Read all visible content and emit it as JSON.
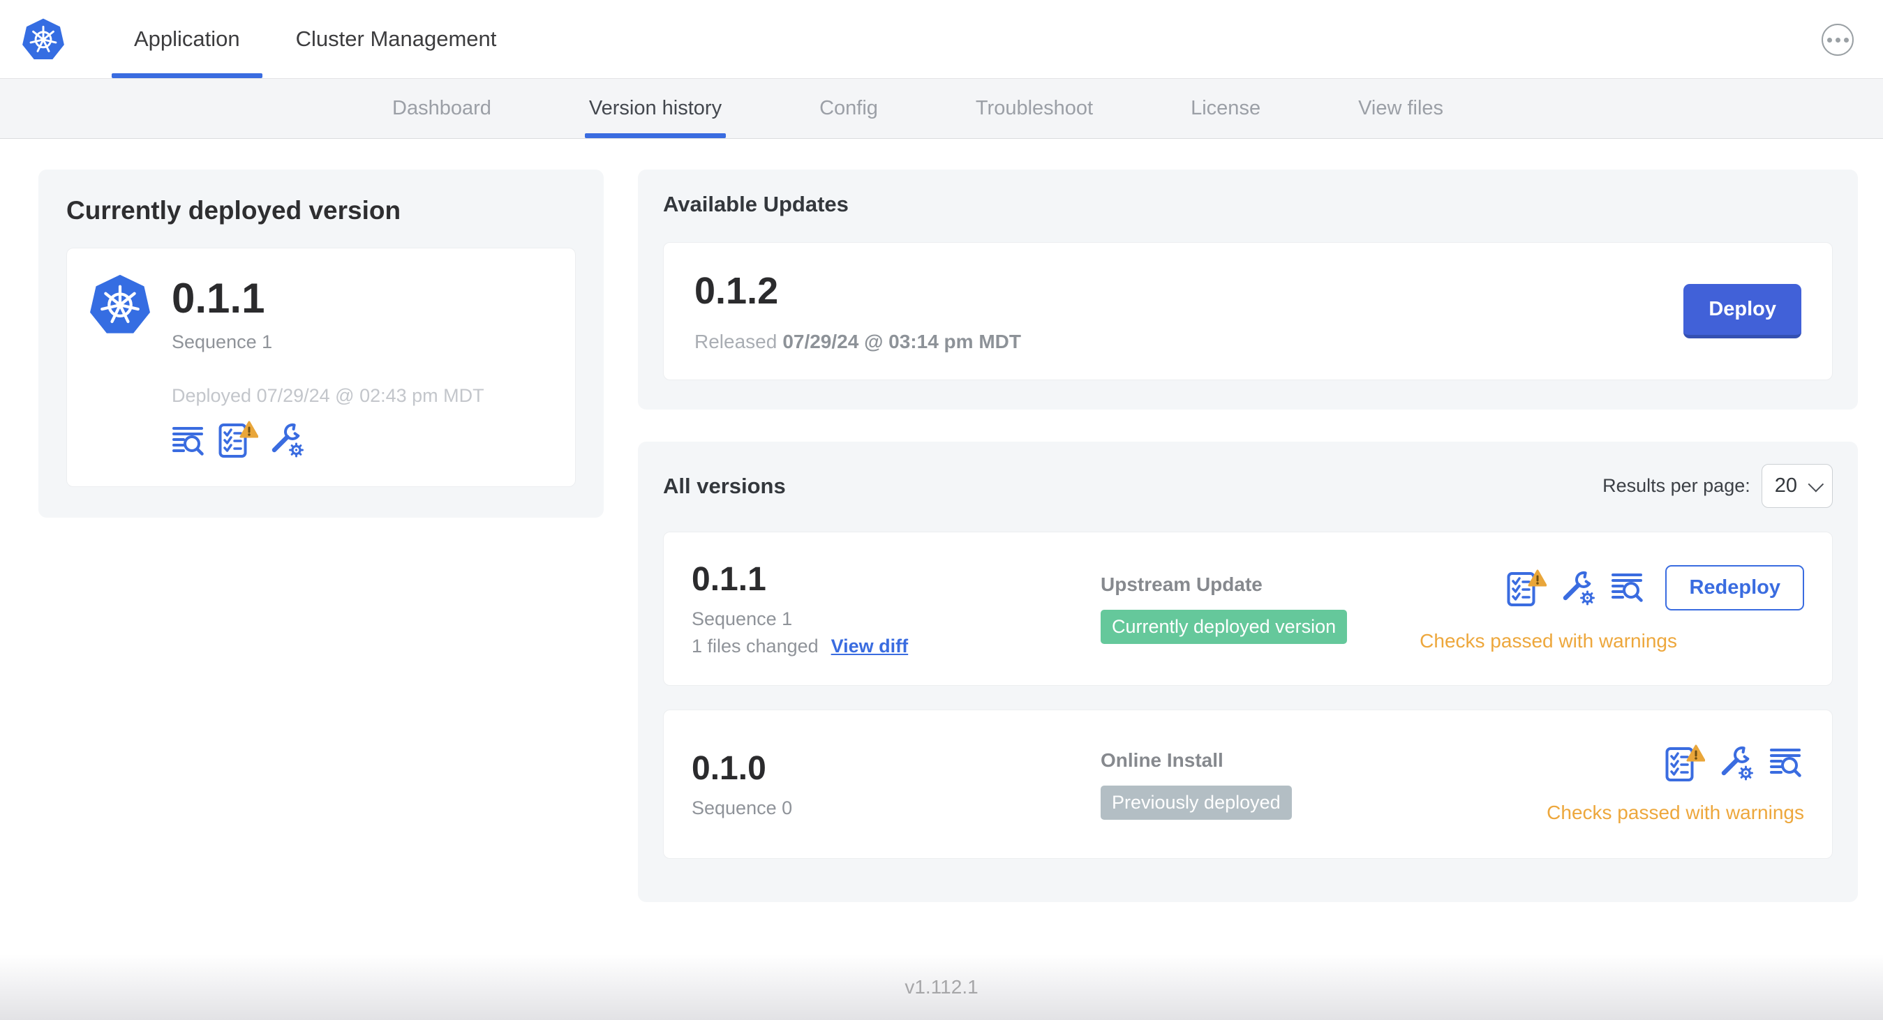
{
  "header": {
    "tabs": [
      {
        "label": "Application",
        "active": true
      },
      {
        "label": "Cluster Management",
        "active": false
      }
    ]
  },
  "subnav": {
    "items": [
      {
        "label": "Dashboard",
        "active": false
      },
      {
        "label": "Version history",
        "active": true
      },
      {
        "label": "Config",
        "active": false
      },
      {
        "label": "Troubleshoot",
        "active": false
      },
      {
        "label": "License",
        "active": false
      },
      {
        "label": "View files",
        "active": false
      }
    ]
  },
  "current": {
    "title": "Currently deployed version",
    "version": "0.1.1",
    "sequence": "Sequence 1",
    "deployed": "Deployed 07/29/24 @ 02:43 pm MDT",
    "icons": [
      "view-logs-icon",
      "preflight-checks-warning-icon",
      "edit-config-icon"
    ]
  },
  "updates": {
    "title": "Available Updates",
    "version": "0.1.2",
    "released_label": "Released",
    "released_date": "07/29/24 @ 03:14 pm MDT",
    "deploy_label": "Deploy"
  },
  "versions": {
    "title": "All versions",
    "results_label": "Results per page:",
    "results_value": "20",
    "rows": [
      {
        "version": "0.1.1",
        "sequence": "Sequence 1",
        "files_changed": "1 files changed",
        "view_diff": "View diff",
        "source": "Upstream Update",
        "badge": "Currently deployed version",
        "badge_color": "#65c89b",
        "status": "Checks passed with warnings",
        "action": "Redeploy",
        "icons": [
          "preflight-checks-warning-icon",
          "edit-config-icon",
          "view-logs-icon"
        ]
      },
      {
        "version": "0.1.0",
        "sequence": "Sequence 0",
        "source": "Online Install",
        "badge": "Previously deployed",
        "badge_color": "#b3bec4",
        "status": "Checks passed with warnings",
        "icons": [
          "preflight-checks-warning-icon",
          "edit-config-icon",
          "view-logs-icon"
        ]
      }
    ]
  },
  "footer": {
    "version": "v1.112.1"
  },
  "colors": {
    "accent_blue": "#3a6ce0",
    "button_blue": "#4161d8",
    "kubernetes_blue": "#356de2",
    "badge_green": "#65c89b",
    "badge_gray": "#b3bec4",
    "warning_orange": "#eda73c",
    "card_background": "#f4f6f8"
  }
}
